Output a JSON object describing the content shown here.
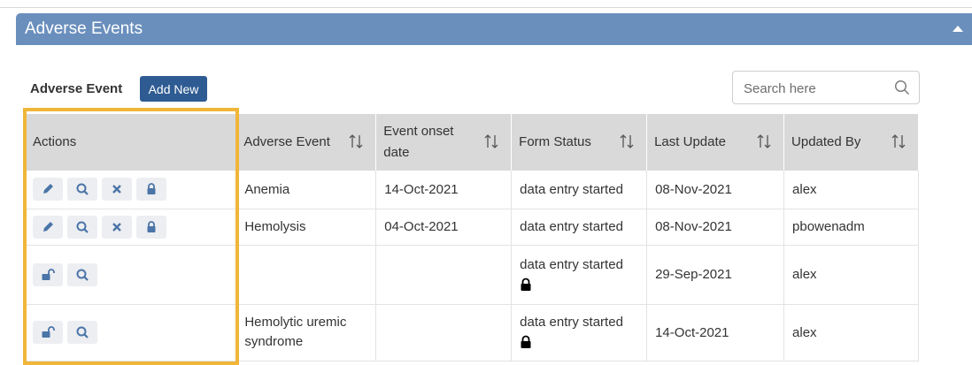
{
  "panel": {
    "title": "Adverse Events"
  },
  "section": {
    "label": "Adverse Event",
    "add_new": "Add New"
  },
  "search": {
    "placeholder": "Search here"
  },
  "table": {
    "headers": {
      "actions": "Actions",
      "adverse_event": "Adverse Event",
      "onset": "Event onset date",
      "status": "Form Status",
      "last_update": "Last Update",
      "updated_by": "Updated By"
    },
    "rows": [
      {
        "adverse_event": "Anemia",
        "onset": "14-Oct-2021",
        "status": "data entry started",
        "last_update": "08-Nov-2021",
        "updated_by": "alex"
      },
      {
        "adverse_event": "Hemolysis",
        "onset": "04-Oct-2021",
        "status": "data entry started",
        "last_update": "08-Nov-2021",
        "updated_by": "pbowenadm"
      },
      {
        "adverse_event": "",
        "onset": "",
        "status": "data entry started",
        "last_update": "29-Sep-2021",
        "updated_by": "alex"
      },
      {
        "adverse_event": "Hemolytic uremic syndrome",
        "onset": "",
        "status": "data entry started",
        "last_update": "14-Oct-2021",
        "updated_by": "alex"
      }
    ]
  },
  "colors": {
    "header": "#6a8fbd",
    "button": "#2e5b92",
    "highlight": "#f0b63a",
    "table_header": "#d9d9d9",
    "icon": "#4b74a8"
  }
}
